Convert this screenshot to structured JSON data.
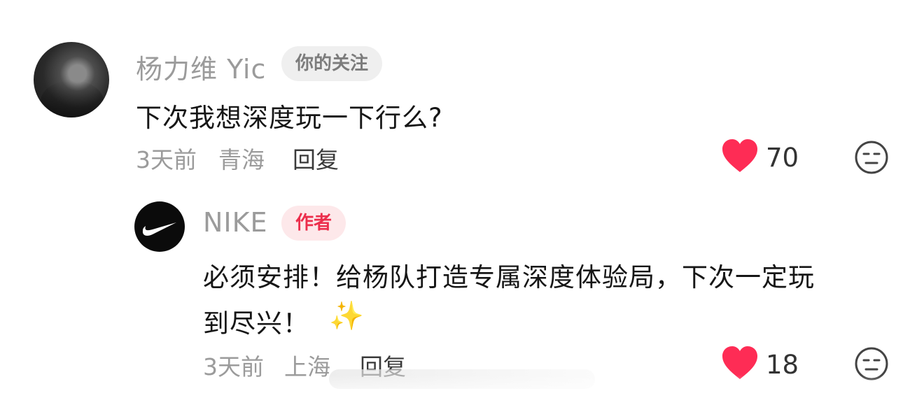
{
  "comments": [
    {
      "username": "杨力维 Yic",
      "badge": "你的关注",
      "text": "下次我想深度玩一下行么?",
      "time": "3天前",
      "location": "青海",
      "reply_label": "回复",
      "likes": "70",
      "like_icon": "heart-icon",
      "dislike_icon": "dislike-face-icon",
      "colors": {
        "heart": "#fe2c55",
        "badge_bg": "#efefef",
        "badge_text": "#7c7c7c"
      }
    },
    {
      "username": "NIKE",
      "badge": "作者",
      "text_line1": "必须安排！给杨队打造专属深度体验局，下次一定玩",
      "text_line2": "到尽兴！",
      "emoji": "✨",
      "time": "3天前",
      "location": "上海",
      "reply_label": "回复",
      "likes": "18",
      "like_icon": "heart-icon",
      "dislike_icon": "dislike-face-icon",
      "colors": {
        "heart": "#fe2c55",
        "badge_bg": "#fde8ea",
        "badge_text": "#ec2e4c"
      }
    }
  ]
}
